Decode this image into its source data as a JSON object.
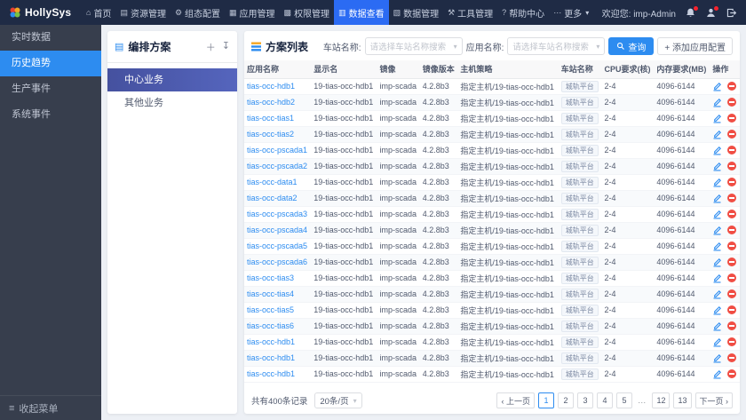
{
  "navbar": {
    "logo_text": "HollySys",
    "items": [
      {
        "label": "首页",
        "icon": "home",
        "active": false
      },
      {
        "label": "资源管理",
        "icon": "resource",
        "active": false
      },
      {
        "label": "组态配置",
        "icon": "config",
        "active": false
      },
      {
        "label": "应用管理",
        "icon": "app",
        "active": false
      },
      {
        "label": "权限管理",
        "icon": "permission",
        "active": false
      },
      {
        "label": "数据查看",
        "icon": "data-view",
        "active": true
      },
      {
        "label": "数据管理",
        "icon": "data-manage",
        "active": false
      },
      {
        "label": "工具管理",
        "icon": "tools",
        "active": false
      },
      {
        "label": "帮助中心",
        "icon": "help",
        "active": false
      },
      {
        "label": "更多",
        "icon": "more",
        "active": false,
        "caret": true
      }
    ],
    "welcome": "欢迎您: imp-Admin"
  },
  "sidebar": {
    "items": [
      {
        "label": "实时数据",
        "active": false
      },
      {
        "label": "历史趋势",
        "active": true
      },
      {
        "label": "生产事件",
        "active": false
      },
      {
        "label": "系统事件",
        "active": false
      }
    ],
    "collapse": "收起菜单"
  },
  "plan_panel": {
    "title": "编排方案",
    "items": [
      {
        "label": "中心业务",
        "active": true
      },
      {
        "label": "其他业务",
        "active": false
      }
    ]
  },
  "list_panel": {
    "title": "方案列表",
    "filters": {
      "station_label": "车站名称:",
      "station_placeholder": "请选择车站名称搜索",
      "app_label": "应用名称:",
      "app_placeholder": "请选择车站名称搜索",
      "search_button": "查询",
      "add_button": "+ 添加应用配置"
    },
    "table": {
      "headers": [
        "应用名称",
        "显示名",
        "镜像",
        "镜像版本",
        "主机策略",
        "车站名称",
        "CPU要求(核)",
        "内存要求(MB)",
        "操作"
      ],
      "rows": [
        [
          "tias-occ-hdb1",
          "19-tias-occ-hdb1",
          "imp-scada",
          "4.2.8b3",
          "指定主机/19-tias-occ-hdb1",
          "城轨平台",
          "2-4",
          "4096-6144"
        ],
        [
          "tias-occ-hdb2",
          "19-tias-occ-hdb1",
          "imp-scada",
          "4.2.8b3",
          "指定主机/19-tias-occ-hdb1",
          "城轨平台",
          "2-4",
          "4096-6144"
        ],
        [
          "tias-occ-tias1",
          "19-tias-occ-hdb1",
          "imp-scada",
          "4.2.8b3",
          "指定主机/19-tias-occ-hdb1",
          "城轨平台",
          "2-4",
          "4096-6144"
        ],
        [
          "tias-occ-tias2",
          "19-tias-occ-hdb1",
          "imp-scada",
          "4.2.8b3",
          "指定主机/19-tias-occ-hdb1",
          "城轨平台",
          "2-4",
          "4096-6144"
        ],
        [
          "tias-occ-pscada1",
          "19-tias-occ-hdb1",
          "imp-scada",
          "4.2.8b3",
          "指定主机/19-tias-occ-hdb1",
          "城轨平台",
          "2-4",
          "4096-6144"
        ],
        [
          "tias-occ-pscada2",
          "19-tias-occ-hdb1",
          "imp-scada",
          "4.2.8b3",
          "指定主机/19-tias-occ-hdb1",
          "城轨平台",
          "2-4",
          "4096-6144"
        ],
        [
          "tias-occ-data1",
          "19-tias-occ-hdb1",
          "imp-scada",
          "4.2.8b3",
          "指定主机/19-tias-occ-hdb1",
          "城轨平台",
          "2-4",
          "4096-6144"
        ],
        [
          "tias-occ-data2",
          "19-tias-occ-hdb1",
          "imp-scada",
          "4.2.8b3",
          "指定主机/19-tias-occ-hdb1",
          "城轨平台",
          "2-4",
          "4096-6144"
        ],
        [
          "tias-occ-pscada3",
          "19-tias-occ-hdb1",
          "imp-scada",
          "4.2.8b3",
          "指定主机/19-tias-occ-hdb1",
          "城轨平台",
          "2-4",
          "4096-6144"
        ],
        [
          "tias-occ-pscada4",
          "19-tias-occ-hdb1",
          "imp-scada",
          "4.2.8b3",
          "指定主机/19-tias-occ-hdb1",
          "城轨平台",
          "2-4",
          "4096-6144"
        ],
        [
          "tias-occ-pscada5",
          "19-tias-occ-hdb1",
          "imp-scada",
          "4.2.8b3",
          "指定主机/19-tias-occ-hdb1",
          "城轨平台",
          "2-4",
          "4096-6144"
        ],
        [
          "tias-occ-pscada6",
          "19-tias-occ-hdb1",
          "imp-scada",
          "4.2.8b3",
          "指定主机/19-tias-occ-hdb1",
          "城轨平台",
          "2-4",
          "4096-6144"
        ],
        [
          "tias-occ-tias3",
          "19-tias-occ-hdb1",
          "imp-scada",
          "4.2.8b3",
          "指定主机/19-tias-occ-hdb1",
          "城轨平台",
          "2-4",
          "4096-6144"
        ],
        [
          "tias-occ-tias4",
          "19-tias-occ-hdb1",
          "imp-scada",
          "4.2.8b3",
          "指定主机/19-tias-occ-hdb1",
          "城轨平台",
          "2-4",
          "4096-6144"
        ],
        [
          "tias-occ-tias5",
          "19-tias-occ-hdb1",
          "imp-scada",
          "4.2.8b3",
          "指定主机/19-tias-occ-hdb1",
          "城轨平台",
          "2-4",
          "4096-6144"
        ],
        [
          "tias-occ-tias6",
          "19-tias-occ-hdb1",
          "imp-scada",
          "4.2.8b3",
          "指定主机/19-tias-occ-hdb1",
          "城轨平台",
          "2-4",
          "4096-6144"
        ],
        [
          "tias-occ-hdb1",
          "19-tias-occ-hdb1",
          "imp-scada",
          "4.2.8b3",
          "指定主机/19-tias-occ-hdb1",
          "城轨平台",
          "2-4",
          "4096-6144"
        ],
        [
          "tias-occ-hdb1",
          "19-tias-occ-hdb1",
          "imp-scada",
          "4.2.8b3",
          "指定主机/19-tias-occ-hdb1",
          "城轨平台",
          "2-4",
          "4096-6144"
        ],
        [
          "tias-occ-hdb1",
          "19-tias-occ-hdb1",
          "imp-scada",
          "4.2.8b3",
          "指定主机/19-tias-occ-hdb1",
          "城轨平台",
          "2-4",
          "4096-6144"
        ]
      ]
    },
    "footer": {
      "total": "共有400条记录",
      "page_size": "20条/页",
      "prev": "上一页",
      "next": "下一页",
      "pages": [
        "1",
        "2",
        "3",
        "4",
        "5",
        "...",
        "12",
        "13"
      ],
      "active_page": "1"
    }
  },
  "colors": {
    "accent": "#2d8cf0",
    "navbar_active": "#2b6bf3",
    "danger": "#f04d43",
    "plan_active": "#45519f"
  }
}
